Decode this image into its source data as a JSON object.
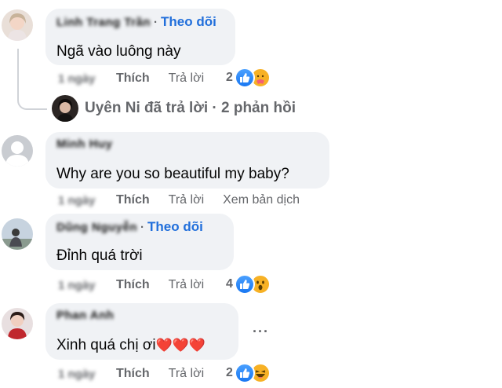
{
  "colors": {
    "link": "#216fdb",
    "muted": "#65676b",
    "bubble": "#f0f2f5",
    "like": "#1877f2"
  },
  "comments": [
    {
      "name": "Linh Trang Trần",
      "follow": "Theo dõi",
      "text": "Ngã vào luông này",
      "time": "1 ngày",
      "like_label": "Thích",
      "reply_label": "Trả lời",
      "reaction_count": "2",
      "reactions": [
        "like-icon",
        "care-icon"
      ]
    },
    {
      "name": "Minh Huy",
      "text": "Why are you so beautiful my baby?",
      "time": "1 ngày",
      "like_label": "Thích",
      "reply_label": "Trả lời",
      "translate_label": "Xem bản dịch"
    },
    {
      "name": "Dũng Nguyễn",
      "follow": "Theo dõi",
      "text": "Đỉnh quá trời",
      "time": "1 ngày",
      "like_label": "Thích",
      "reply_label": "Trả lời",
      "reaction_count": "4",
      "reactions": [
        "like-icon",
        "wow-icon"
      ]
    },
    {
      "name": "Phan Anh",
      "text": "Xinh quá chị ơi",
      "hearts": "❤️❤️❤️",
      "time": "1 ngày",
      "like_label": "Thích",
      "reply_label": "Trả lời",
      "reaction_count": "2",
      "reactions": [
        "like-icon",
        "haha-icon"
      ]
    }
  ],
  "replies_summary": "Uyên Ni đã trả lời · 2 phản hồi"
}
